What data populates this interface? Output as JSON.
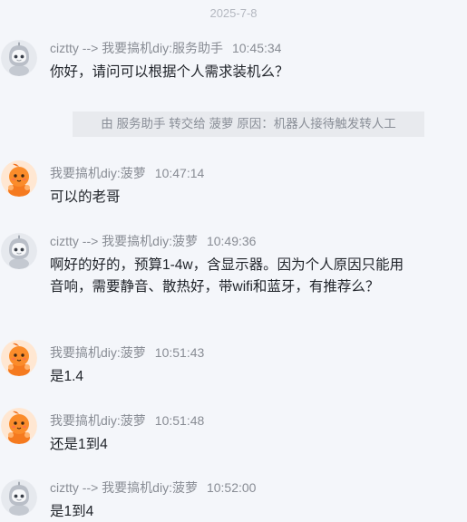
{
  "date_divider": "2025-7-8",
  "transfer_notice": "由 服务助手 转交给 菠萝 原因：机器人接待触发转人工",
  "messages": [
    {
      "sender": "ciztty --> 我要搞机diy:服务助手",
      "time": "10:45:34",
      "text": "你好，请问可以根据个人需求装机么？",
      "avatar": "robot-avatar-icon"
    },
    {
      "sender": "我要搞机diy:菠萝",
      "time": "10:47:14",
      "text": "可以的老哥",
      "avatar": "orange-mascot-avatar-icon"
    },
    {
      "sender": "ciztty --> 我要搞机diy:菠萝",
      "time": "10:49:36",
      "text": "啊好的好的，预算1-4w，含显示器。因为个人原因只能用音响，需要静音、散热好，带wifi和蓝牙，有推荐么？",
      "avatar": "robot-avatar-icon"
    },
    {
      "sender": "我要搞机diy:菠萝",
      "time": "10:51:43",
      "text": "是1.4",
      "avatar": "orange-mascot-avatar-icon"
    },
    {
      "sender": "我要搞机diy:菠萝",
      "time": "10:51:48",
      "text": "还是1到4",
      "avatar": "orange-mascot-avatar-icon"
    },
    {
      "sender": "ciztty --> 我要搞机diy:菠萝",
      "time": "10:52:00",
      "text": "是1到4",
      "avatar": "robot-avatar-icon"
    }
  ]
}
